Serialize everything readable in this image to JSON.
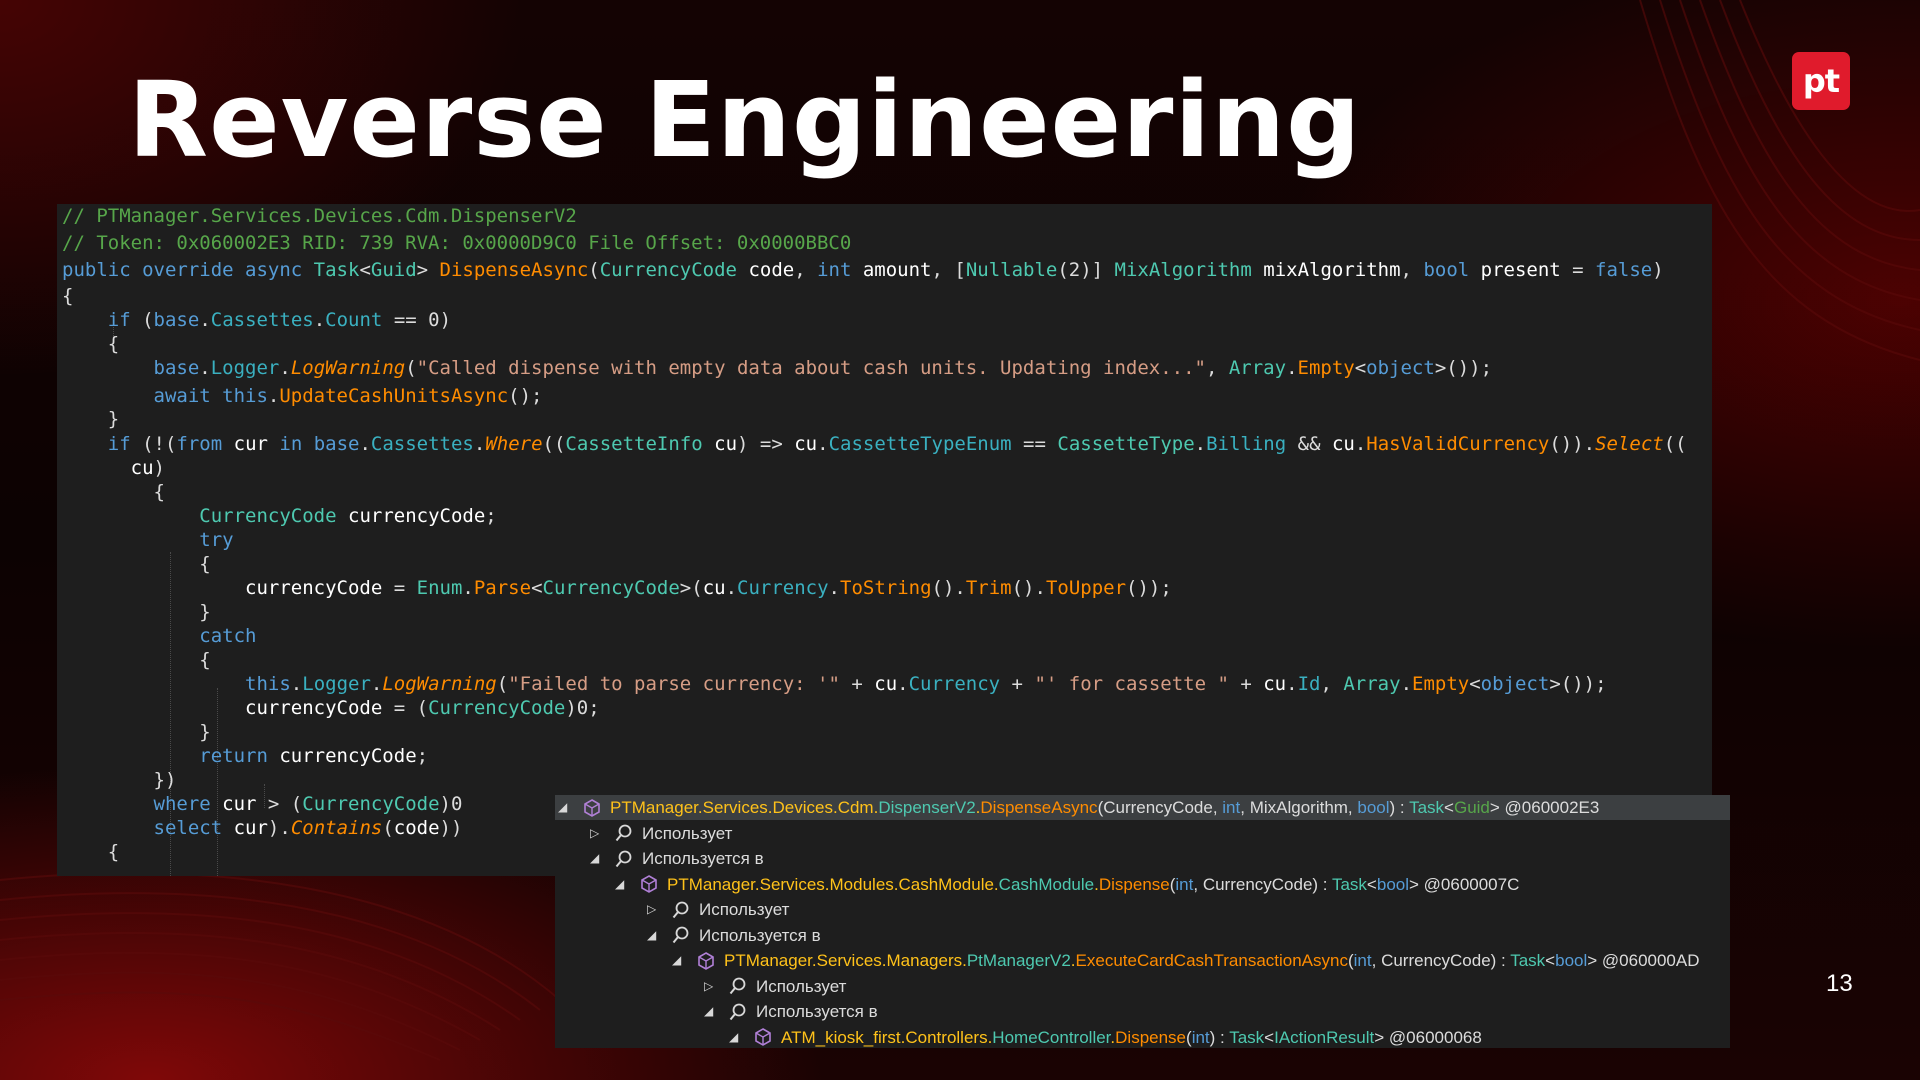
{
  "slide": {
    "title": "Reverse Engineering",
    "logo_text": "pt",
    "page_number": "13"
  },
  "code_lines": [
    [
      {
        "c": "cm",
        "t": "// PTManager.Services.Devices.Cdm.DispenserV2"
      }
    ],
    [
      {
        "c": "cm",
        "t": "// Token: 0x060002E3 RID: 739 RVA: 0x0000D9C0 File Offset: 0x0000BBC0"
      }
    ],
    [
      {
        "c": "kw",
        "t": "public override async "
      },
      {
        "c": "ty",
        "t": "Task"
      },
      {
        "c": "pl",
        "t": "<"
      },
      {
        "c": "ty",
        "t": "Guid"
      },
      {
        "c": "pl",
        "t": "> "
      },
      {
        "c": "mt",
        "t": "DispenseAsync"
      },
      {
        "c": "pl",
        "t": "("
      },
      {
        "c": "ty",
        "t": "CurrencyCode"
      },
      {
        "c": "id",
        "t": " code"
      },
      {
        "c": "pl",
        "t": ", "
      },
      {
        "c": "kw",
        "t": "int"
      },
      {
        "c": "id",
        "t": " amount"
      },
      {
        "c": "pl",
        "t": ", ["
      },
      {
        "c": "ty",
        "t": "Nullable"
      },
      {
        "c": "pl",
        "t": "(2)] "
      },
      {
        "c": "ty",
        "t": "MixAlgorithm"
      },
      {
        "c": "id",
        "t": " mixAlgorithm"
      },
      {
        "c": "pl",
        "t": ", "
      },
      {
        "c": "kw",
        "t": "bool"
      },
      {
        "c": "id",
        "t": " present"
      },
      {
        "c": "pl",
        "t": " = "
      },
      {
        "c": "kw",
        "t": "false"
      },
      {
        "c": "pl",
        "t": ")"
      }
    ],
    [
      {
        "c": "pl",
        "t": "{"
      }
    ],
    [
      {
        "c": "pl",
        "t": "    "
      },
      {
        "c": "kw",
        "t": "if"
      },
      {
        "c": "pl",
        "t": " ("
      },
      {
        "c": "kw",
        "t": "base"
      },
      {
        "c": "pl",
        "t": "."
      },
      {
        "c": "pr",
        "t": "Cassettes"
      },
      {
        "c": "pl",
        "t": "."
      },
      {
        "c": "pr",
        "t": "Count"
      },
      {
        "c": "pl",
        "t": " == 0)"
      }
    ],
    [
      {
        "c": "pl",
        "t": "    {"
      }
    ],
    [
      {
        "c": "pl",
        "t": "        "
      },
      {
        "c": "kw",
        "t": "base"
      },
      {
        "c": "pl",
        "t": "."
      },
      {
        "c": "pr",
        "t": "Logger"
      },
      {
        "c": "pl",
        "t": "."
      },
      {
        "c": "ext",
        "t": "LogWarning"
      },
      {
        "c": "pl",
        "t": "("
      },
      {
        "c": "st",
        "t": "\"Called dispense with empty data about cash units. Updating index...\""
      },
      {
        "c": "pl",
        "t": ", "
      },
      {
        "c": "ty",
        "t": "Array"
      },
      {
        "c": "pl",
        "t": "."
      },
      {
        "c": "mt",
        "t": "Empty"
      },
      {
        "c": "pl",
        "t": "<"
      },
      {
        "c": "kw",
        "t": "object"
      },
      {
        "c": "pl",
        "t": ">());"
      }
    ],
    [
      {
        "c": "pl",
        "t": "        "
      },
      {
        "c": "kw",
        "t": "await this"
      },
      {
        "c": "pl",
        "t": "."
      },
      {
        "c": "mt",
        "t": "UpdateCashUnitsAsync"
      },
      {
        "c": "pl",
        "t": "();"
      }
    ],
    [
      {
        "c": "pl",
        "t": "    }"
      }
    ],
    [
      {
        "c": "pl",
        "t": "    "
      },
      {
        "c": "kw",
        "t": "if"
      },
      {
        "c": "pl",
        "t": " (!("
      },
      {
        "c": "kw",
        "t": "from"
      },
      {
        "c": "id",
        "t": " cur "
      },
      {
        "c": "kw",
        "t": "in base"
      },
      {
        "c": "pl",
        "t": "."
      },
      {
        "c": "pr",
        "t": "Cassettes"
      },
      {
        "c": "pl",
        "t": "."
      },
      {
        "c": "ext",
        "t": "Where"
      },
      {
        "c": "pl",
        "t": "(("
      },
      {
        "c": "ty",
        "t": "CassetteInfo"
      },
      {
        "c": "id",
        "t": " cu"
      },
      {
        "c": "pl",
        "t": ") => "
      },
      {
        "c": "id",
        "t": "cu"
      },
      {
        "c": "pl",
        "t": "."
      },
      {
        "c": "pr",
        "t": "CassetteTypeEnum"
      },
      {
        "c": "pl",
        "t": " == "
      },
      {
        "c": "ty",
        "t": "CassetteType"
      },
      {
        "c": "pl",
        "t": "."
      },
      {
        "c": "pr",
        "t": "Billing"
      },
      {
        "c": "pl",
        "t": " && "
      },
      {
        "c": "id",
        "t": "cu"
      },
      {
        "c": "pl",
        "t": "."
      },
      {
        "c": "mt",
        "t": "HasValidCurrency"
      },
      {
        "c": "pl",
        "t": "())."
      },
      {
        "c": "ext",
        "t": "Select"
      },
      {
        "c": "pl",
        "t": "(("
      }
    ],
    [
      {
        "c": "pl",
        "t": "      "
      },
      {
        "c": "id",
        "t": "cu"
      },
      {
        "c": "pl",
        "t": ")"
      }
    ],
    [
      {
        "c": "pl",
        "t": "        {"
      }
    ],
    [
      {
        "c": "pl",
        "t": "            "
      },
      {
        "c": "ty",
        "t": "CurrencyCode"
      },
      {
        "c": "id",
        "t": " currencyCode"
      },
      {
        "c": "pl",
        "t": ";"
      }
    ],
    [
      {
        "c": "pl",
        "t": "            "
      },
      {
        "c": "kw",
        "t": "try"
      }
    ],
    [
      {
        "c": "pl",
        "t": "            {"
      }
    ],
    [
      {
        "c": "pl",
        "t": "                "
      },
      {
        "c": "id",
        "t": "currencyCode"
      },
      {
        "c": "pl",
        "t": " = "
      },
      {
        "c": "ty",
        "t": "Enum"
      },
      {
        "c": "pl",
        "t": "."
      },
      {
        "c": "mt",
        "t": "Parse"
      },
      {
        "c": "pl",
        "t": "<"
      },
      {
        "c": "ty",
        "t": "CurrencyCode"
      },
      {
        "c": "pl",
        "t": ">("
      },
      {
        "c": "id",
        "t": "cu"
      },
      {
        "c": "pl",
        "t": "."
      },
      {
        "c": "pr",
        "t": "Currency"
      },
      {
        "c": "pl",
        "t": "."
      },
      {
        "c": "mt",
        "t": "ToString"
      },
      {
        "c": "pl",
        "t": "()."
      },
      {
        "c": "mt",
        "t": "Trim"
      },
      {
        "c": "pl",
        "t": "()."
      },
      {
        "c": "mt",
        "t": "ToUpper"
      },
      {
        "c": "pl",
        "t": "());"
      }
    ],
    [
      {
        "c": "pl",
        "t": "            }"
      }
    ],
    [
      {
        "c": "pl",
        "t": "            "
      },
      {
        "c": "kw",
        "t": "catch"
      }
    ],
    [
      {
        "c": "pl",
        "t": "            {"
      }
    ],
    [
      {
        "c": "pl",
        "t": "                "
      },
      {
        "c": "kw",
        "t": "this"
      },
      {
        "c": "pl",
        "t": "."
      },
      {
        "c": "pr",
        "t": "Logger"
      },
      {
        "c": "pl",
        "t": "."
      },
      {
        "c": "ext",
        "t": "LogWarning"
      },
      {
        "c": "pl",
        "t": "("
      },
      {
        "c": "st",
        "t": "\"Failed to parse currency: '\""
      },
      {
        "c": "pl",
        "t": " + "
      },
      {
        "c": "id",
        "t": "cu"
      },
      {
        "c": "pl",
        "t": "."
      },
      {
        "c": "pr",
        "t": "Currency"
      },
      {
        "c": "pl",
        "t": " + "
      },
      {
        "c": "st",
        "t": "\"' for cassette \""
      },
      {
        "c": "pl",
        "t": " + "
      },
      {
        "c": "id",
        "t": "cu"
      },
      {
        "c": "pl",
        "t": "."
      },
      {
        "c": "pr",
        "t": "Id"
      },
      {
        "c": "pl",
        "t": ", "
      },
      {
        "c": "ty",
        "t": "Array"
      },
      {
        "c": "pl",
        "t": "."
      },
      {
        "c": "mt",
        "t": "Empty"
      },
      {
        "c": "pl",
        "t": "<"
      },
      {
        "c": "kw",
        "t": "object"
      },
      {
        "c": "pl",
        "t": ">());"
      }
    ],
    [
      {
        "c": "pl",
        "t": "                "
      },
      {
        "c": "id",
        "t": "currencyCode"
      },
      {
        "c": "pl",
        "t": " = ("
      },
      {
        "c": "ty",
        "t": "CurrencyCode"
      },
      {
        "c": "pl",
        "t": ")0;"
      }
    ],
    [
      {
        "c": "pl",
        "t": "            }"
      }
    ],
    [
      {
        "c": "pl",
        "t": "            "
      },
      {
        "c": "kw",
        "t": "return"
      },
      {
        "c": "id",
        "t": " currencyCode"
      },
      {
        "c": "pl",
        "t": ";"
      }
    ],
    [
      {
        "c": "pl",
        "t": "        })"
      }
    ],
    [
      {
        "c": "pl",
        "t": "        "
      },
      {
        "c": "kw",
        "t": "where"
      },
      {
        "c": "id",
        "t": " cur"
      },
      {
        "c": "pl",
        "t": " > ("
      },
      {
        "c": "ty",
        "t": "CurrencyCode"
      },
      {
        "c": "pl",
        "t": ")0"
      }
    ],
    [
      {
        "c": "pl",
        "t": "        "
      },
      {
        "c": "kw",
        "t": "select"
      },
      {
        "c": "id",
        "t": " cur"
      },
      {
        "c": "pl",
        "t": ")."
      },
      {
        "c": "ext",
        "t": "Contains"
      },
      {
        "c": "pl",
        "t": "("
      },
      {
        "c": "id",
        "t": "code"
      },
      {
        "c": "pl",
        "t": "))"
      }
    ],
    [
      {
        "c": "pl",
        "t": "    {"
      }
    ]
  ],
  "tree": [
    {
      "arrow": "expanded",
      "icon": "method-icon",
      "segs": [
        {
          "c": "tns",
          "t": "PTManager.Services.Devices.Cdm."
        },
        {
          "c": "tcls",
          "t": "DispenserV2"
        },
        {
          "c": "tns",
          "t": "."
        },
        {
          "c": "tmt",
          "t": "DispenseAsync"
        },
        {
          "c": "twh",
          "t": "(CurrencyCode, "
        },
        {
          "c": "tkw",
          "t": "int"
        },
        {
          "c": "twh",
          "t": ", MixAlgorithm, "
        },
        {
          "c": "tkw",
          "t": "bool"
        },
        {
          "c": "twh",
          "t": ") : "
        },
        {
          "c": "tty",
          "t": "Task"
        },
        {
          "c": "twh",
          "t": "<"
        },
        {
          "c": "tgr",
          "t": "Guid"
        },
        {
          "c": "twh",
          "t": "> @060002E3"
        }
      ]
    },
    {
      "arrow": "collapsed",
      "icon": "search-icon",
      "segs": [
        {
          "c": "twh",
          "t": "Использует"
        }
      ]
    },
    {
      "arrow": "expanded",
      "icon": "search-icon",
      "segs": [
        {
          "c": "twh",
          "t": "Используется в"
        }
      ]
    },
    {
      "arrow": "expanded",
      "icon": "method-icon",
      "segs": [
        {
          "c": "tns",
          "t": "PTManager.Services.Modules.CashModule."
        },
        {
          "c": "tcls",
          "t": "CashModule"
        },
        {
          "c": "tns",
          "t": "."
        },
        {
          "c": "tmt",
          "t": "Dispense"
        },
        {
          "c": "twh",
          "t": "("
        },
        {
          "c": "tkw",
          "t": "int"
        },
        {
          "c": "twh",
          "t": ", CurrencyCode) : "
        },
        {
          "c": "tty",
          "t": "Task"
        },
        {
          "c": "twh",
          "t": "<"
        },
        {
          "c": "tkw",
          "t": "bool"
        },
        {
          "c": "twh",
          "t": "> @0600007C"
        }
      ]
    },
    {
      "arrow": "collapsed",
      "icon": "search-icon",
      "segs": [
        {
          "c": "twh",
          "t": "Использует"
        }
      ]
    },
    {
      "arrow": "expanded",
      "icon": "search-icon",
      "segs": [
        {
          "c": "twh",
          "t": "Используется в"
        }
      ]
    },
    {
      "arrow": "expanded",
      "icon": "method-icon",
      "segs": [
        {
          "c": "tns",
          "t": "PTManager.Services.Managers."
        },
        {
          "c": "tcls",
          "t": "PtManagerV2"
        },
        {
          "c": "tns",
          "t": "."
        },
        {
          "c": "tmt",
          "t": "ExecuteCardCashTransactionAsync"
        },
        {
          "c": "twh",
          "t": "("
        },
        {
          "c": "tkw",
          "t": "int"
        },
        {
          "c": "twh",
          "t": ", CurrencyCode) : "
        },
        {
          "c": "tty",
          "t": "Task"
        },
        {
          "c": "twh",
          "t": "<"
        },
        {
          "c": "tkw",
          "t": "bool"
        },
        {
          "c": "twh",
          "t": "> @060000AD"
        }
      ]
    },
    {
      "arrow": "collapsed",
      "icon": "search-icon",
      "segs": [
        {
          "c": "twh",
          "t": "Использует"
        }
      ]
    },
    {
      "arrow": "expanded",
      "icon": "search-icon",
      "segs": [
        {
          "c": "twh",
          "t": "Используется в"
        }
      ]
    },
    {
      "arrow": "expanded",
      "icon": "method-icon",
      "segs": [
        {
          "c": "tns",
          "t": "ATM_kiosk_first.Controllers."
        },
        {
          "c": "tcls",
          "t": "HomeController"
        },
        {
          "c": "tns",
          "t": "."
        },
        {
          "c": "tmt",
          "t": "Dispense"
        },
        {
          "c": "twh",
          "t": "("
        },
        {
          "c": "tkw",
          "t": "int"
        },
        {
          "c": "twh",
          "t": ") : "
        },
        {
          "c": "tty",
          "t": "Task"
        },
        {
          "c": "twh",
          "t": "<"
        },
        {
          "c": "tty",
          "t": "IActionResult"
        },
        {
          "c": "twh",
          "t": "> @06000068"
        }
      ]
    }
  ]
}
